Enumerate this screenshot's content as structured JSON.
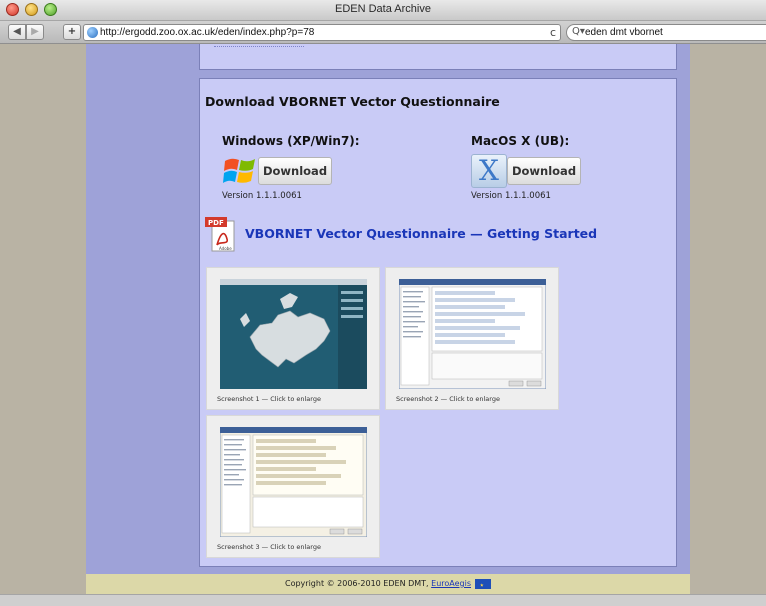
{
  "window": {
    "title": "EDEN Data Archive"
  },
  "toolbar": {
    "back_glyph": "◀",
    "forward_glyph": "▶",
    "add_glyph": "+",
    "url": "http://ergodd.zoo.ox.ac.uk/eden/index.php?p=78",
    "reload_glyph": "c",
    "search_icon_glyph": "Q▾",
    "search_value": "eden dmt vbornet"
  },
  "panel": {
    "heading": "Download VBORNET Vector Questionnaire",
    "windows": {
      "label": "Windows (XP/Win7):",
      "button": "Download",
      "version": "Version 1.1.1.0061"
    },
    "mac": {
      "label": "MacOS X (UB):",
      "button": "Download",
      "logo_letter": "X",
      "version": "Version 1.1.1.0061"
    },
    "pdf": {
      "badge": "PDF",
      "badge_sub": "Adobe",
      "link": "VBORNET Vector Questionnaire — Getting Started"
    },
    "screenshots": [
      {
        "caption": "Screenshot 1 — Click to enlarge"
      },
      {
        "caption": "Screenshot 2 — Click to enlarge"
      },
      {
        "caption": "Screenshot 3 — Click to enlarge"
      }
    ]
  },
  "footer": {
    "copyright": "Copyright © 2006-2010 EDEN DMT, ",
    "link": "EuroAegis"
  },
  "colors": {
    "panel_bg": "#c9cbf6",
    "column_bg": "#9ea2d8",
    "link": "#1a36b8",
    "footer_bg": "#dcd8a8"
  }
}
